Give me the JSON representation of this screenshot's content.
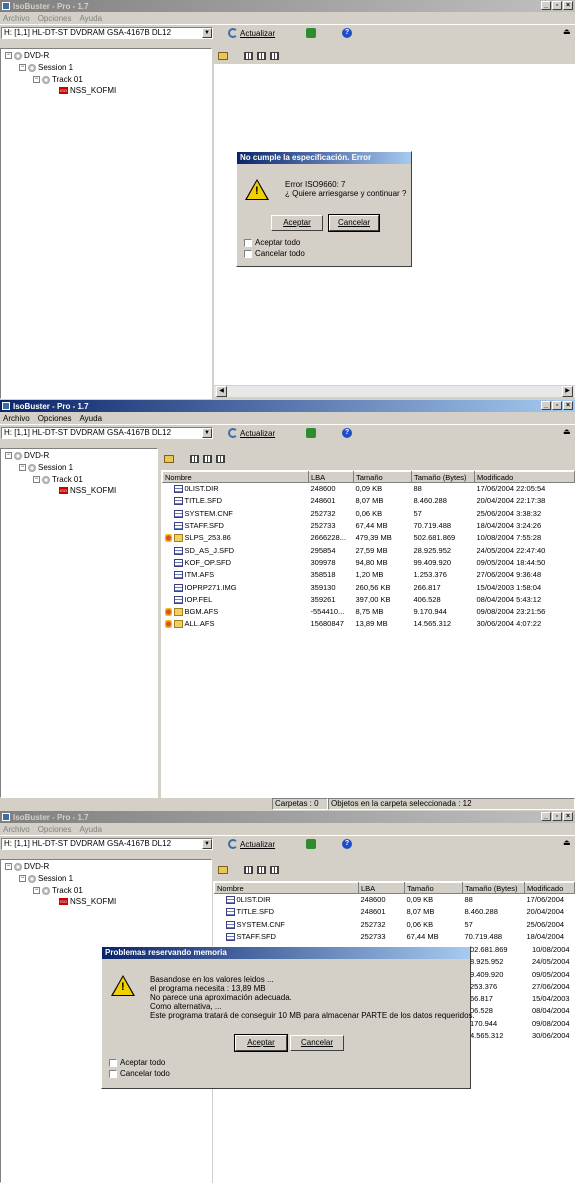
{
  "window1": {
    "title": "IsoBuster - Pro - 1.7",
    "menu": [
      "Archivo",
      "Opciones",
      "Ayuda"
    ],
    "drive": "H: [1,1]  HL-DT-ST  DVDRAM GSA-4167B  DL12",
    "refresh_label": "Actualizar",
    "tree": [
      "DVD-R",
      "Session 1",
      "Track 01",
      "NSS_KOFMI"
    ],
    "dialog": {
      "title": "No cumple la especificación. Error",
      "line1": "Error ISO9660: 7",
      "line2": "¿ Quiere arriesgarse y continuar ?",
      "accept": "Aceptar",
      "cancel": "Cancelar",
      "check1": "Aceptar todo",
      "check2": "Cancelar todo"
    }
  },
  "window2": {
    "title": "IsoBuster - Pro - 1.7",
    "menu": [
      "Archivo",
      "Opciones",
      "Ayuda"
    ],
    "drive": "H: [1,1]  HL-DT-ST  DVDRAM GSA-4167B  DL12",
    "refresh_label": "Actualizar",
    "tree": [
      "DVD-R",
      "Session 1",
      "Track 01",
      "NSS_KOFMI"
    ],
    "columns": [
      "Nombre",
      "LBA",
      "Tamaño",
      "Tamaño (Bytes)",
      "Modificado"
    ],
    "rows": [
      {
        "icon": "file",
        "name": "0LIST.DIR",
        "lba": "248600",
        "size": "0,09 KB",
        "bytes": "88",
        "mod": "17/06/2004 22:05:54"
      },
      {
        "icon": "file",
        "name": "TITLE.SFD",
        "lba": "248601",
        "size": "8,07 MB",
        "bytes": "8.460.288",
        "mod": "20/04/2004 22:17:38"
      },
      {
        "icon": "file",
        "name": "SYSTEM.CNF",
        "lba": "252732",
        "size": "0,06 KB",
        "bytes": "57",
        "mod": "25/06/2004 3:38:32"
      },
      {
        "icon": "file",
        "name": "STAFF.SFD",
        "lba": "252733",
        "size": "67,44 MB",
        "bytes": "70.719.488",
        "mod": "18/04/2004 3:24:26"
      },
      {
        "icon": "folder-x",
        "name": "SLPS_253.86",
        "lba": "2666228...",
        "size": "479,39 MB",
        "bytes": "502.681.869",
        "mod": "10/08/2004 7:55:28"
      },
      {
        "icon": "file",
        "name": "SD_AS_J.SFD",
        "lba": "295854",
        "size": "27,59 MB",
        "bytes": "28.925.952",
        "mod": "24/05/2004 22:47:40"
      },
      {
        "icon": "file",
        "name": "KOF_OP.SFD",
        "lba": "309978",
        "size": "94,80 MB",
        "bytes": "99.409.920",
        "mod": "09/05/2004 18:44:50"
      },
      {
        "icon": "file",
        "name": "ITM.AFS",
        "lba": "358518",
        "size": "1,20 MB",
        "bytes": "1.253.376",
        "mod": "27/06/2004 9:36:48"
      },
      {
        "icon": "file",
        "name": "IOPRP271.IMG",
        "lba": "359130",
        "size": "260,56 KB",
        "bytes": "266.817",
        "mod": "15/04/2003 1:58:04"
      },
      {
        "icon": "file",
        "name": "IOP.FEL",
        "lba": "359261",
        "size": "397,00 KB",
        "bytes": "406.528",
        "mod": "08/04/2004 5:43:12"
      },
      {
        "icon": "folder-x",
        "name": "BGM.AFS",
        "lba": "-554410...",
        "size": "8,75 MB",
        "bytes": "9.170.944",
        "mod": "09/08/2004 23:21:56"
      },
      {
        "icon": "folder-x",
        "name": "ALL.AFS",
        "lba": "15680847",
        "size": "13,89 MB",
        "bytes": "14.565.312",
        "mod": "30/06/2004 4:07:22"
      }
    ],
    "status_left": "Carpetas : 0",
    "status_right": "Objetos en la carpeta seleccionada : 12"
  },
  "window3": {
    "title": "IsoBuster - Pro - 1.7",
    "menu": [
      "Archivo",
      "Opciones",
      "Ayuda"
    ],
    "drive": "H: [1,1]  HL-DT-ST  DVDRAM GSA-4167B  DL12",
    "refresh_label": "Actualizar",
    "tree": [
      "DVD-R",
      "Session 1",
      "Track 01",
      "NSS_KOFMI"
    ],
    "columns": [
      "Nombre",
      "LBA",
      "Tamaño",
      "Tamaño (Bytes)",
      "Modificado"
    ],
    "rows": [
      {
        "icon": "file",
        "name": "0LIST.DIR",
        "lba": "248600",
        "size": "0,09 KB",
        "bytes": "88",
        "mod": "17/06/2004"
      },
      {
        "icon": "file",
        "name": "TITLE.SFD",
        "lba": "248601",
        "size": "8,07 MB",
        "bytes": "8.460.288",
        "mod": "20/04/2004"
      },
      {
        "icon": "file",
        "name": "SYSTEM.CNF",
        "lba": "252732",
        "size": "0,06 KB",
        "bytes": "57",
        "mod": "25/06/2004"
      },
      {
        "icon": "file",
        "name": "STAFF.SFD",
        "lba": "252733",
        "size": "67,44 MB",
        "bytes": "70.719.488",
        "mod": "18/04/2004"
      }
    ],
    "partial_bytes": [
      "02.681.869",
      "8.925.952",
      "9.409.920",
      "253.376",
      "66.817",
      "06.528",
      "170.944",
      "4.565.312"
    ],
    "partial_mod": [
      "10/08/2004",
      "24/05/2004",
      "09/05/2004",
      "27/06/2004",
      "15/04/2003",
      "08/04/2004",
      "09/08/2004",
      "30/06/2004"
    ],
    "dialog": {
      "title": "Problemas reservando memoria",
      "lines": [
        "Basandose en los valores leidos ...",
        "el programa necesita : 13,89 MB",
        "No parece una aproximación adecuada.",
        "Como alternativa, ...",
        "Este programa tratará de conseguir 10 MB para almacenar PARTE de los datos requeridos."
      ],
      "accept": "Aceptar",
      "cancel": "Cancelar",
      "check1": "Aceptar todo",
      "check2": "Cancelar todo"
    }
  }
}
